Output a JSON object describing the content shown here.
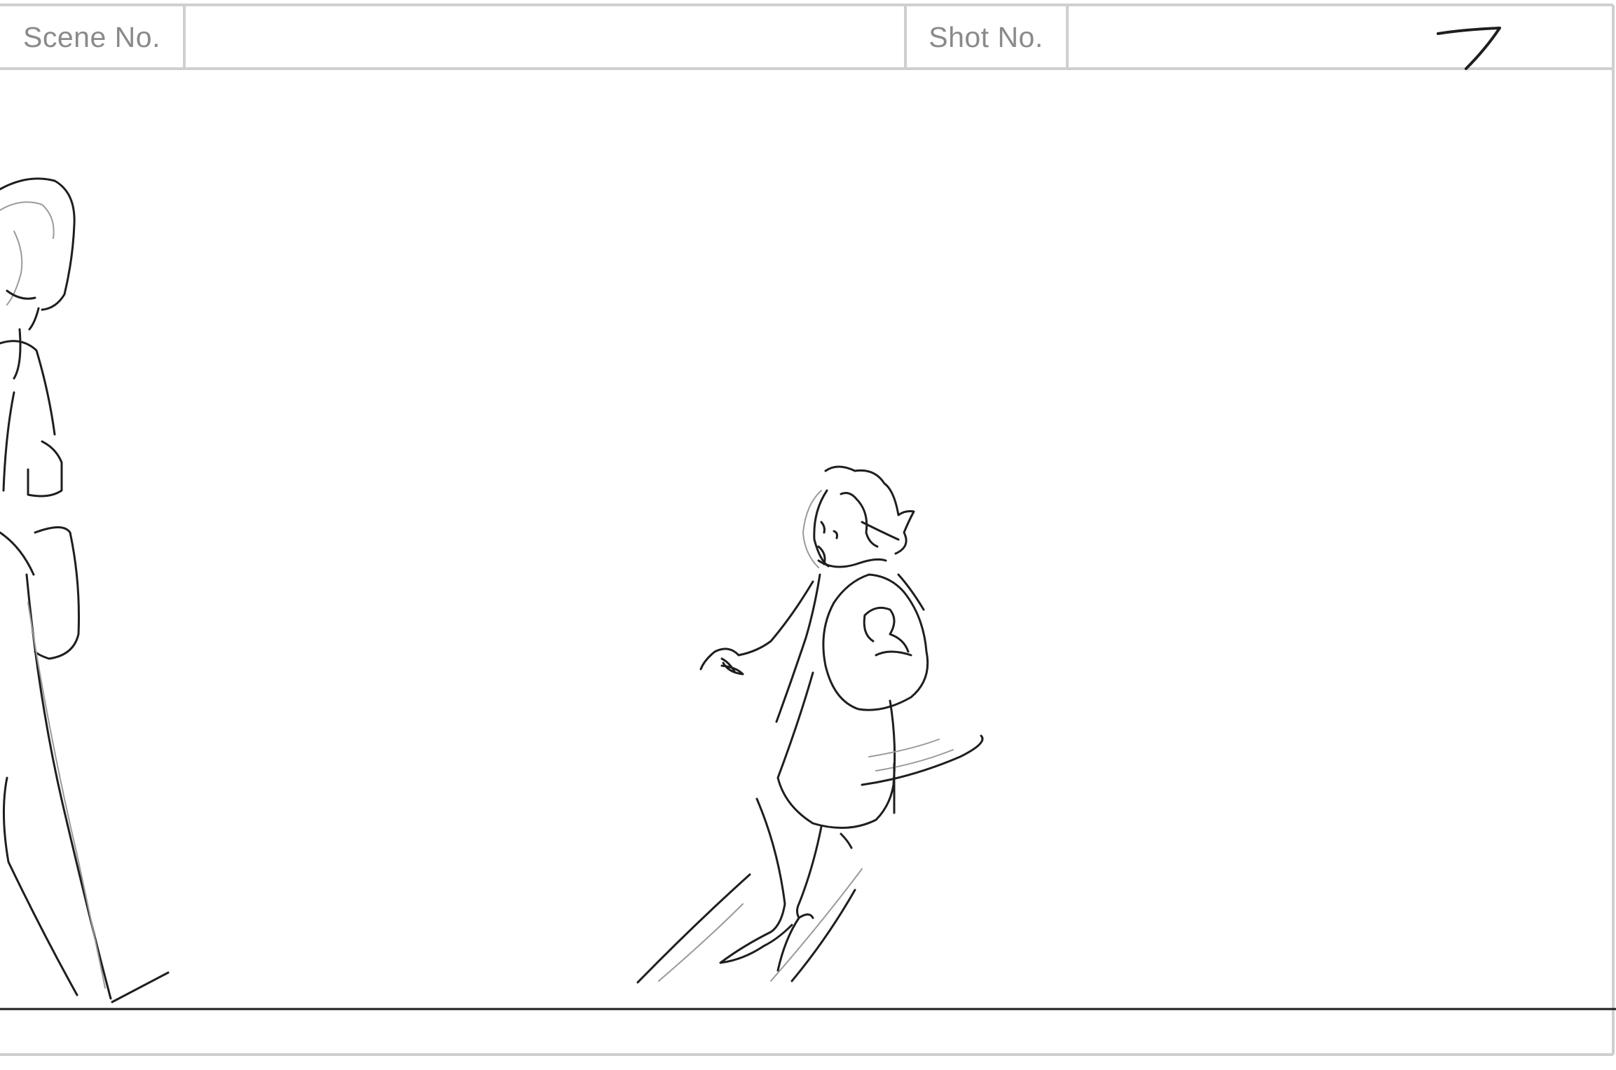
{
  "header": {
    "scene_label": "Scene No.",
    "scene_value": "",
    "shot_label": "Shot No.",
    "shot_value": ""
  },
  "panel": {
    "handwritten_number": "7"
  },
  "colors": {
    "frame_line": "#cfcfcf",
    "label_text": "#8a8a8a",
    "sketch_stroke": "#1e1e1e",
    "sketch_light": "#9a9a9a"
  }
}
